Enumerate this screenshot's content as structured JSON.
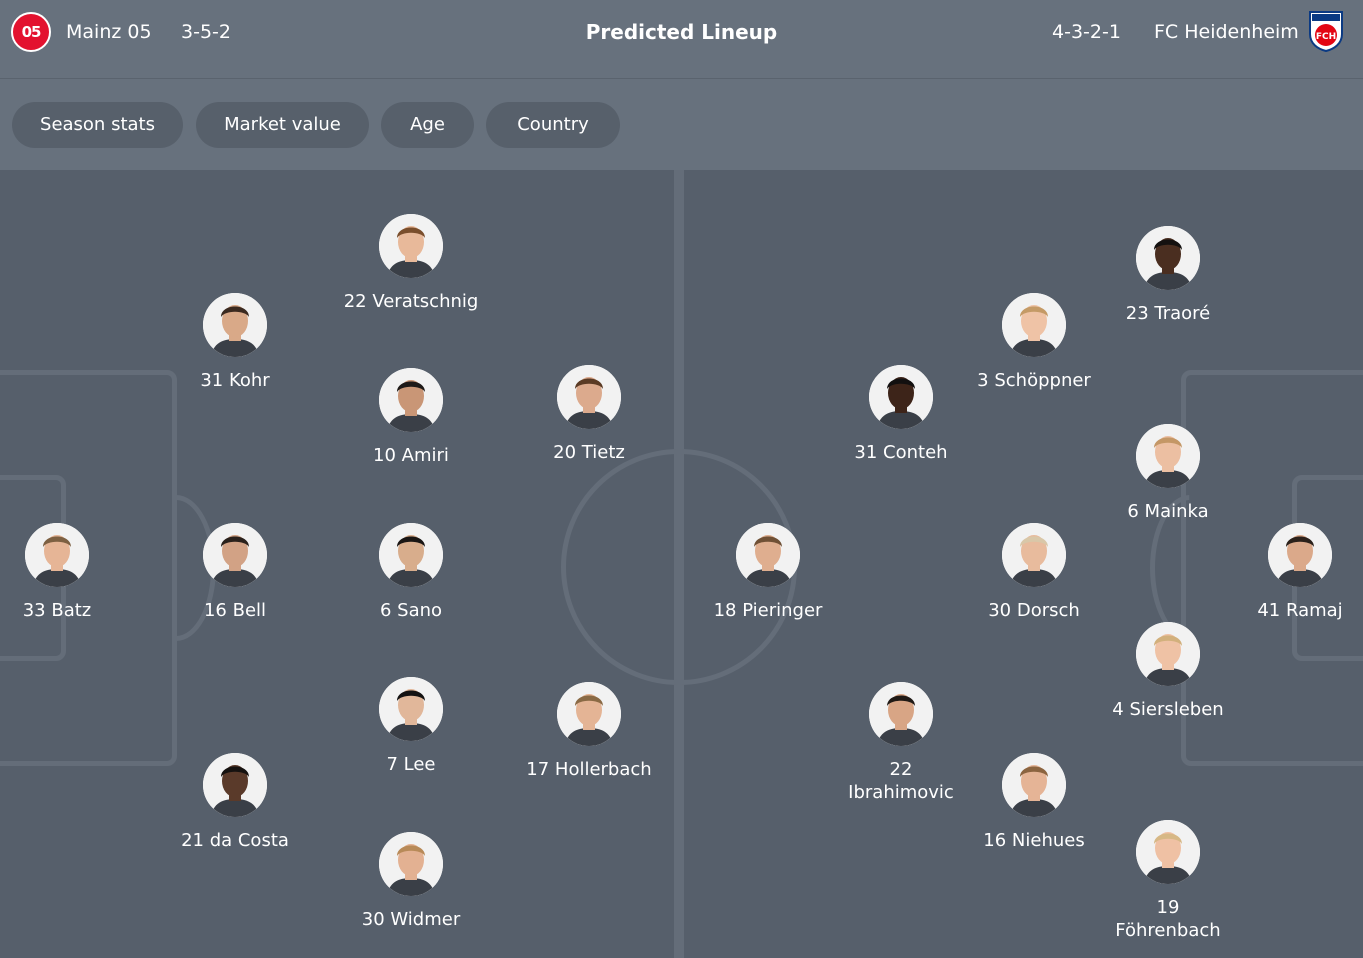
{
  "header": {
    "home_team": "Mainz 05",
    "home_formation": "3-5-2",
    "home_logo_text": "05",
    "title": "Predicted Lineup",
    "away_formation": "4-3-2-1",
    "away_team": "FC Heidenheim",
    "away_logo_text": "FCH"
  },
  "filters": [
    "Season stats",
    "Market value",
    "Age",
    "Country"
  ],
  "home_players": [
    {
      "label": "22 Veratschnig",
      "skin": "#e8b99a",
      "hair": "#7a4e2c"
    },
    {
      "label": "31 Kohr",
      "skin": "#d9a988",
      "hair": "#3b2a20"
    },
    {
      "label": "10 Amiri",
      "skin": "#c99676",
      "hair": "#1e1a18"
    },
    {
      "label": "20 Tietz",
      "skin": "#dcaa8d",
      "hair": "#5b3b25"
    },
    {
      "label": "33 Batz",
      "skin": "#e6b596",
      "hair": "#7d6042"
    },
    {
      "label": "16 Bell",
      "skin": "#d2a285",
      "hair": "#2a211c"
    },
    {
      "label": "6 Sano",
      "skin": "#d8ad8c",
      "hair": "#1a1614"
    },
    {
      "label": "7 Lee",
      "skin": "#e1b79a",
      "hair": "#141212"
    },
    {
      "label": "17 Hollerbach",
      "skin": "#e4b495",
      "hair": "#8a6a45"
    },
    {
      "label": "21 da Costa",
      "skin": "#5a3a2a",
      "hair": "#161210"
    },
    {
      "label": "30 Widmer",
      "skin": "#e3b192",
      "hair": "#b88a58"
    }
  ],
  "away_players": [
    {
      "label": "23 Traoré",
      "skin": "#4a2e20",
      "hair": "#141110"
    },
    {
      "label": "3 Schöppner",
      "skin": "#efc3a6",
      "hair": "#c49a66"
    },
    {
      "label": "31 Conteh",
      "skin": "#3d2419",
      "hair": "#121010"
    },
    {
      "label": "6 Mainka",
      "skin": "#ecbfa2",
      "hair": "#c49766"
    },
    {
      "label": "18 Pieringer",
      "skin": "#dfae8f",
      "hair": "#6f5035"
    },
    {
      "label": "30 Dorsch",
      "skin": "#e8bb9d",
      "hair": "#d9c7a8"
    },
    {
      "label": "41 Ramaj",
      "skin": "#dba98a",
      "hair": "#2b211b"
    },
    {
      "label": "4 Siersleben",
      "skin": "#efc2a5",
      "hair": "#d2b07c"
    },
    {
      "label": "22 Ibrahimovic",
      "skin": "#d8a585",
      "hair": "#201a16"
    },
    {
      "label": "16 Niehues",
      "skin": "#e5b496",
      "hair": "#8b6440"
    },
    {
      "label": "19 Föhrenbach",
      "skin": "#efc1a4",
      "hair": "#d7b886"
    }
  ],
  "colors": {
    "pitch": "#565f6b",
    "header": "#67717d",
    "pill": "#57606b",
    "lines": "#646d79",
    "mainz_red": "#e3122f",
    "fch_red": "#e30613",
    "fch_blue": "#0b3a83"
  }
}
